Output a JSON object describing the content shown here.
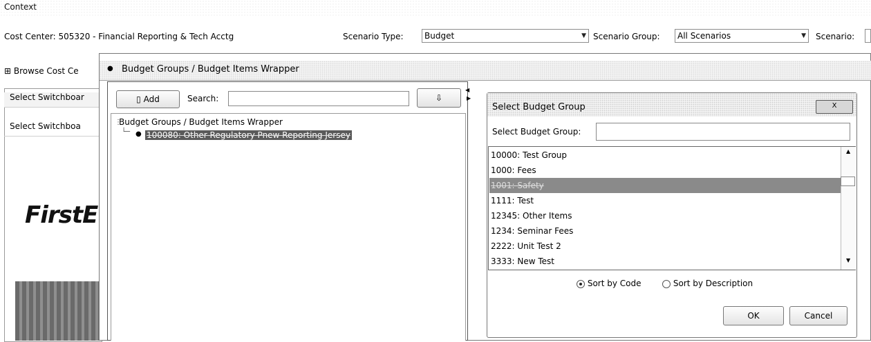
{
  "context": {
    "label": "Context",
    "cost_center": "Cost Center: 505320 - Financial Reporting & Tech Acctg",
    "scenario_type_label": "Scenario Type:",
    "scenario_type_value": "Budget",
    "scenario_group_label": "Scenario Group:",
    "scenario_group_value": "All Scenarios",
    "scenario_label": "Scenario:"
  },
  "background": {
    "browse_tab": "Browse Cost Ce",
    "switchboard_row1": "Select Switchboar",
    "switchboard_row2": "Select Switchboa",
    "logo_text": "FirstE"
  },
  "wrapper": {
    "title": "Budget Groups / Budget Items Wrapper",
    "add_label": "Add",
    "search_label": "Search:",
    "search_value": "",
    "tree_root": "Budget Groups / Budget Items Wrapper",
    "tree_node": "100080: Other Regulatory Pnew Reporting Jersey"
  },
  "dialog": {
    "title": "Select Budget Group",
    "close_label": "X",
    "field_label": "Select Budget Group:",
    "field_value": "",
    "items": [
      "10000: Test Group",
      "1000: Fees",
      "1001: Safety",
      "1111: Test",
      "12345: Other Items",
      "1234: Seminar Fees",
      "2222: Unit Test 2",
      "3333: New Test"
    ],
    "selected_index": 2,
    "sort_by_code": "Sort by Code",
    "sort_by_description": "Sort by Description",
    "sort_selected": "code",
    "ok_label": "OK",
    "cancel_label": "Cancel"
  }
}
